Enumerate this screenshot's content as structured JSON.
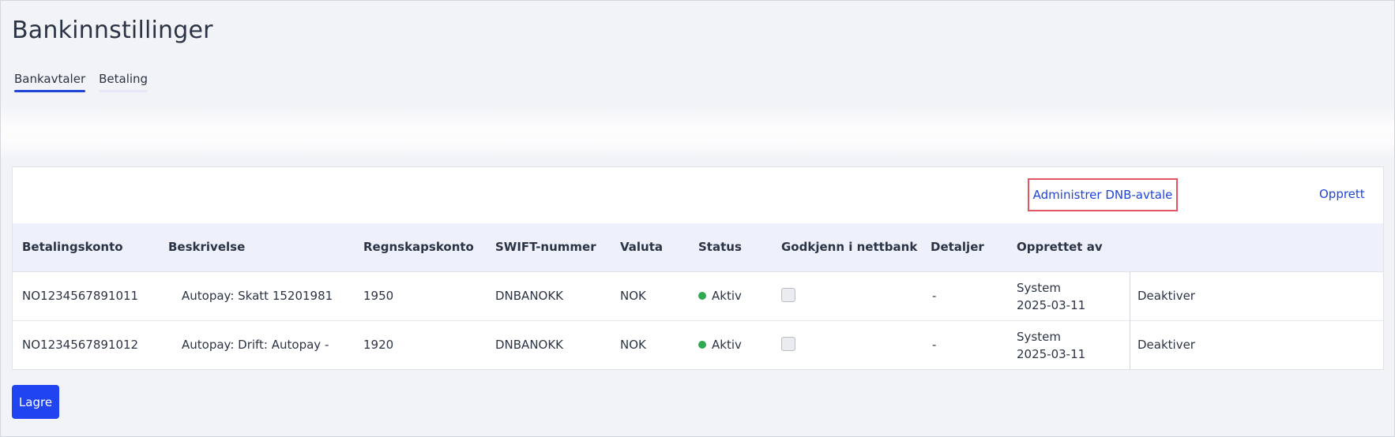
{
  "page": {
    "title": "Bankinnstillinger"
  },
  "tabs": [
    {
      "label": "Bankavtaler",
      "active": true
    },
    {
      "label": "Betaling",
      "active": false
    }
  ],
  "toolbar": {
    "admin_label": "Administrer DNB-avtale",
    "create_label": "Opprett"
  },
  "table": {
    "columns": [
      "Betalingskonto",
      "Beskrivelse",
      "Regnskapskonto",
      "SWIFT-nummer",
      "Valuta",
      "Status",
      "Godkjenn i nettbank",
      "Detaljer",
      "Opprettet av"
    ],
    "rows": [
      {
        "account": "NO1234567891011",
        "description": "Autopay: Skatt 15201981",
        "ledger": "1950",
        "swift": "DNBANOKK",
        "currency": "NOK",
        "status": "Aktiv",
        "approve_in_netbank": false,
        "details": "-",
        "created_by": "System",
        "created_date": "2025-03-11",
        "action": "Deaktiver"
      },
      {
        "account": "NO1234567891012",
        "description": "Autopay: Drift: Autopay -",
        "ledger": "1920",
        "swift": "DNBANOKK",
        "currency": "NOK",
        "status": "Aktiv",
        "approve_in_netbank": false,
        "details": "-",
        "created_by": "System",
        "created_date": "2025-03-11",
        "action": "Deaktiver"
      }
    ]
  },
  "footer": {
    "save_label": "Lagre"
  },
  "colors": {
    "accent": "#1f44d6",
    "save_button": "#1f44f0",
    "status_active": "#2fa84f",
    "highlight_border": "#e05561"
  }
}
